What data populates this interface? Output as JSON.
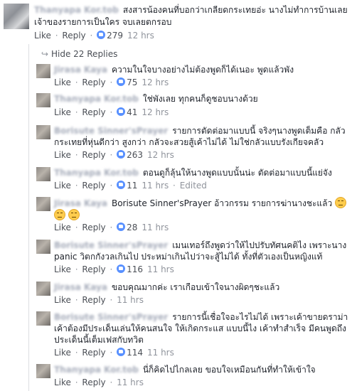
{
  "main_comment": {
    "name": "Thanyapa Kor.tob",
    "line1": "สงสารน้องคนที่บอกว่าเกลียดกระเทยอ่ะ นางไม่ทำการบ้านเลย",
    "line2": "เจ้าของรายการเป็นใคร จบเลยตกรอบ",
    "like_label": "Like",
    "reply_label": "Reply",
    "likes": "279",
    "time": "12 hrs"
  },
  "hide_replies_label": "Hide 22 Replies",
  "replies": [
    {
      "name": "Jirasa Kaya",
      "line1": "ความในใจบางอย่างไม่ต้องพูดก็ได้เนอะ พูดแล้วพัง",
      "likes": "75",
      "time": "12 hrs",
      "like_label": "Like",
      "reply_label": "Reply"
    },
    {
      "name": "Thanyapa Kor.tob",
      "line1": "ใช่พังเลย ทุกคนก็ดูชอบนางด้วย",
      "likes": "41",
      "time": "12 hrs",
      "like_label": "Like",
      "reply_label": "Reply"
    },
    {
      "name": "Borisute Sinner'sPrayer",
      "line1": "รายการตัดต่อมาแบบนี้ จริงๆนางพูดเต็มคือ กลัว",
      "line2": "กระเทยที่หุ่นดีกว่า สูงกว่า กลัวจะสวยสู้เค้าไม่ได้ ไม่ใช่กลัวแบบรังเกียจคลัว",
      "likes": "263",
      "time": "12 hrs",
      "like_label": "Like",
      "reply_label": "Reply"
    },
    {
      "name": "Thanyapa Kor.tob",
      "line1": "ตอนดูก็ลุ้นให้นางพูดแบบนั้นน่ะ ตัดต่อมาแบบนี้แย่จัง",
      "likes": "11",
      "time": "11 hrs",
      "edited": "Edited",
      "like_label": "Like",
      "reply_label": "Reply"
    },
    {
      "name": "Jirasa Kaya",
      "line1": "Borisute Sinner'sPrayer อ้าวกรรม รายการฆ่านางชะแล้ว",
      "likes": "28",
      "time": "11 hrs",
      "like_label": "Like",
      "reply_label": "Reply",
      "emoji": "expressionless-face-icon"
    },
    {
      "name": "Borisute Sinner'sPrayer",
      "line1": "เมนเทอร์ถึงพูดว่าให้ไปปรับทัศนคติไง เพราะนาง",
      "line2": "panic วิตกกังวลเกินไป ประหม่าเกินไปว่าจะสู้ไม่ได้ ทั้งที่ตัวเองเป็นหญิงแท้",
      "likes": "116",
      "time": "11 hrs",
      "like_label": "Like",
      "reply_label": "Reply"
    },
    {
      "name": "Jirasa Kaya",
      "line1": "ขอบคุณมากค่ะ เราเกือบเข้าใจนางผิดๆชะแล้ว",
      "time": "11 hrs",
      "like_label": "Like",
      "reply_label": "Reply"
    },
    {
      "name": "Borisute Sinner'sPrayer",
      "line1": "รายการนี้เชื่อใจอะไรไม่ได้ เพราะเค้าขายดราม่า",
      "line2": "เค้าต้องมีประเด็นเล่นให้คนสนใจ ให้เกิดกระแส แบบนี้ไง เค้าทำสำเร็จ มีคนพูดถึง",
      "line3": "ประเด็นนี้เต็มเฟสกับทวิต",
      "likes": "114",
      "time": "11 hrs",
      "like_label": "Like",
      "reply_label": "Reply"
    },
    {
      "name": "Thanyapa Kor.tob",
      "line1": "นี่ก็คิดไปไกลเลย ขอบใจเหมือนกันที่ทำให้เข้าใจ",
      "time": "11 hrs",
      "like_label": "Like",
      "reply_label": "Reply"
    }
  ]
}
